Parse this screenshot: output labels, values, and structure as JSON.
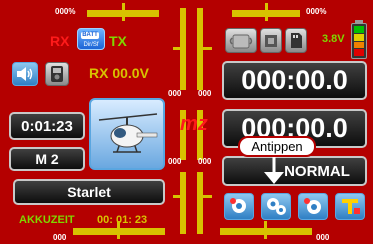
{
  "trims": {
    "top_left_label": "000%",
    "top_right_label": "000%",
    "center_left_label": "000",
    "center_right_label": "000",
    "lower_left_label": "000",
    "lower_right_label": "000",
    "bottom_left_label": "000",
    "bottom_right_label": "000"
  },
  "status": {
    "rx_label": "RX",
    "tx_label": "TX",
    "rx_voltage": "RX 00.0V",
    "tx_voltage": "3.8V",
    "rx_battery_text": "BATT",
    "model_type_text": "Dir/Sf"
  },
  "timers": {
    "top_timer": "000:00.0",
    "bottom_timer": "000:00.0",
    "clock": "0:01:23"
  },
  "model": {
    "memory": "M 2",
    "name": "Starlet",
    "mz_label": "mz",
    "runtime_label": "AKKUZEIT",
    "runtime_value": "00: 01: 23"
  },
  "flight_phase": {
    "label": "NORMAL",
    "tooltip": "Antippen"
  },
  "colors": {
    "background": "#b40000",
    "trim_bar": "#d8c200",
    "accent_green": "#7fd600",
    "accent_blue": "#2f7fc4"
  }
}
